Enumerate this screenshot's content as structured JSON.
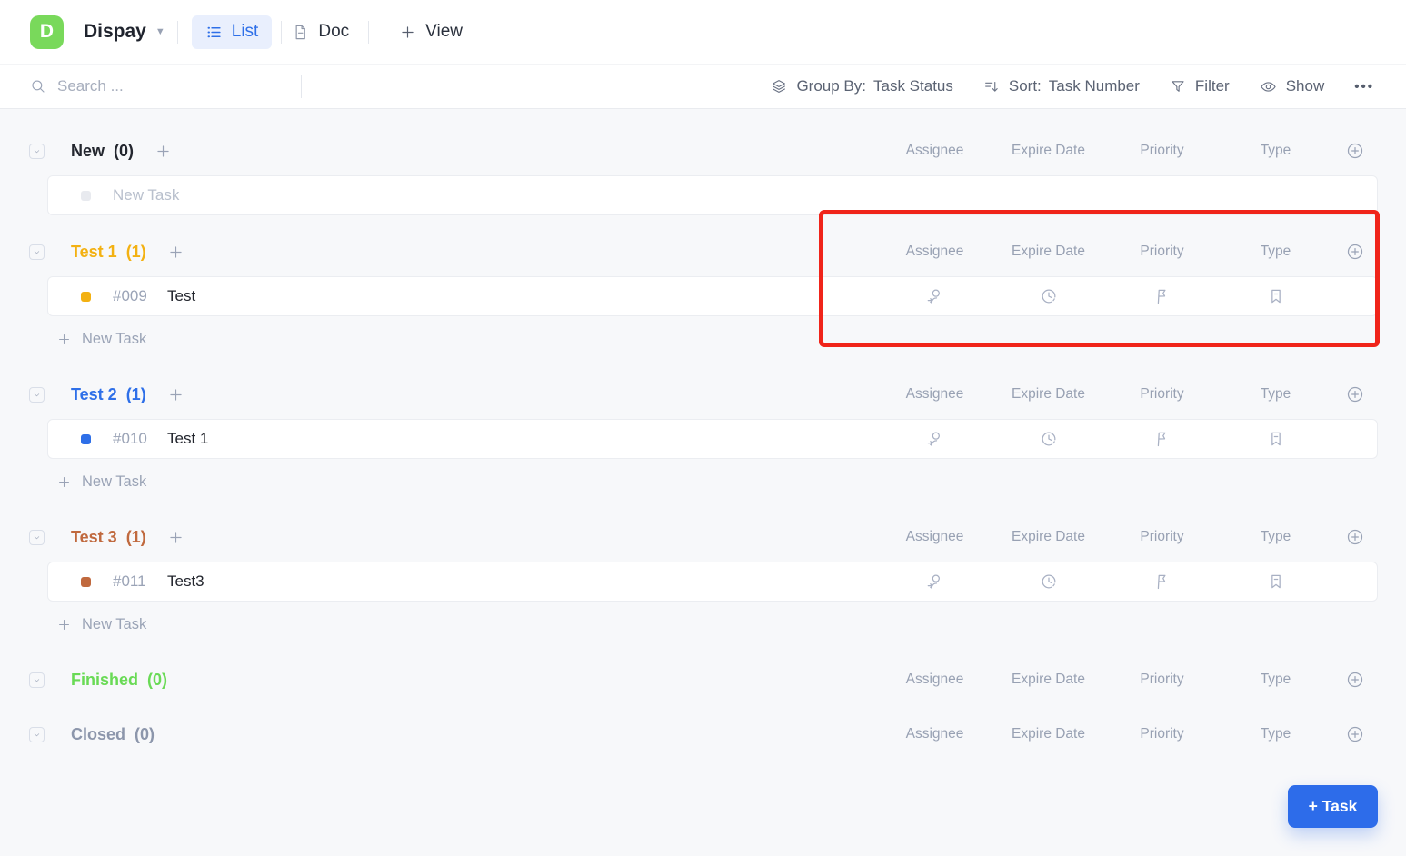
{
  "header": {
    "logo_letter": "D",
    "title": "Dispay",
    "tabs": {
      "list": "List",
      "doc": "Doc",
      "view": "View"
    }
  },
  "toolbar": {
    "search_placeholder": "Search ...",
    "group_by_label": "Group By:",
    "group_by_value": "Task Status",
    "sort_label": "Sort:",
    "sort_value": "Task Number",
    "filter": "Filter",
    "show": "Show",
    "more": "•••"
  },
  "columns": [
    "Assignee",
    "Expire Date",
    "Priority",
    "Type"
  ],
  "groups": [
    {
      "name": "New",
      "count": "(0)",
      "color": "#23262e",
      "new_task_placeholder": "New Task"
    },
    {
      "name": "Test 1",
      "count": "(1)",
      "color": "#f3b112",
      "task": {
        "id": "#009",
        "title": "Test"
      },
      "add_link": "New Task"
    },
    {
      "name": "Test 2",
      "count": "(1)",
      "color": "#2e6fe8",
      "task": {
        "id": "#010",
        "title": "Test 1"
      },
      "add_link": "New Task"
    },
    {
      "name": "Test 3",
      "count": "(1)",
      "color": "#c0693e",
      "task": {
        "id": "#011",
        "title": "Test3"
      },
      "add_link": "New Task"
    },
    {
      "name": "Finished",
      "count": "(0)",
      "color": "#69da55"
    },
    {
      "name": "Closed",
      "count": "(0)",
      "color": "#8c96ab"
    }
  ],
  "floating": {
    "add_task_label": "+ Task"
  },
  "annotation": {
    "color": "#f0241a"
  },
  "colors": {
    "accent_blue": "#2d6cea",
    "logo_green": "#79d95b"
  }
}
